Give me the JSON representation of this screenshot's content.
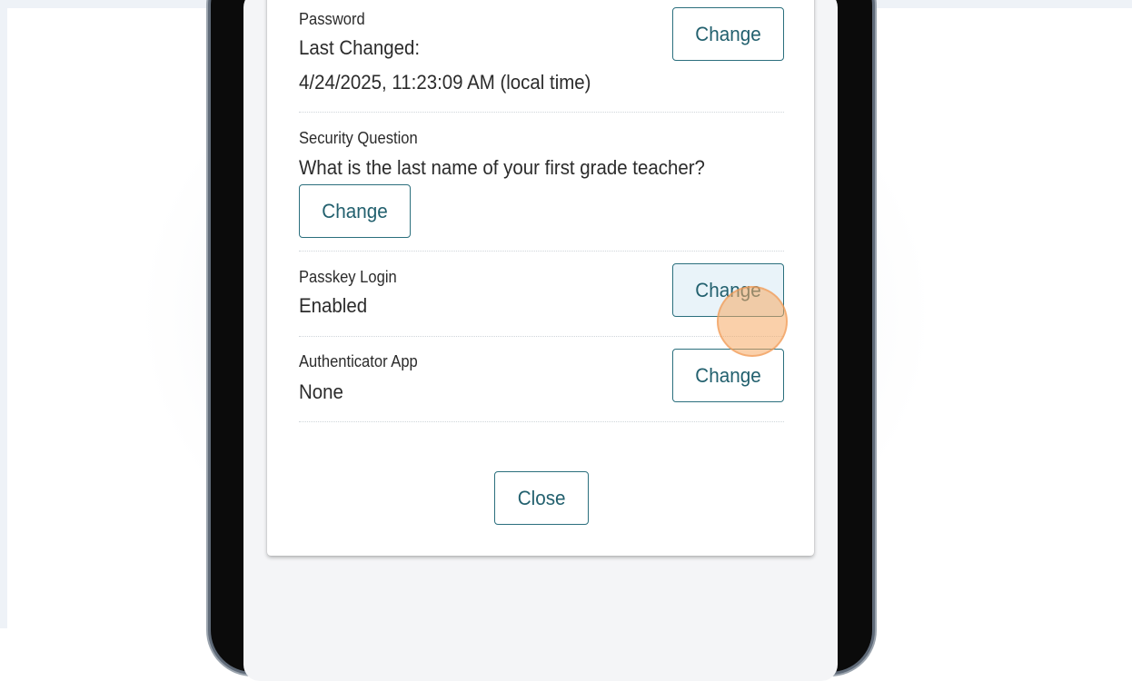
{
  "security": {
    "password": {
      "label": "Password",
      "line1": "Last Changed:",
      "line2": "4/24/2025, 11:23:09 AM (local time)",
      "button": "Change"
    },
    "security_question": {
      "label": "Security Question",
      "value": "What is the last name of your first grade teacher?",
      "button": "Change"
    },
    "passkey": {
      "label": "Passkey Login",
      "value": "Enabled",
      "button": "Change"
    },
    "authenticator": {
      "label": "Authenticator App",
      "value": "None",
      "button": "Change"
    }
  },
  "dialog": {
    "close_label": "Close"
  },
  "colors": {
    "accent": "#2b6f7d",
    "accent_text": "#22606e",
    "click_marker": "#f6aa64"
  }
}
